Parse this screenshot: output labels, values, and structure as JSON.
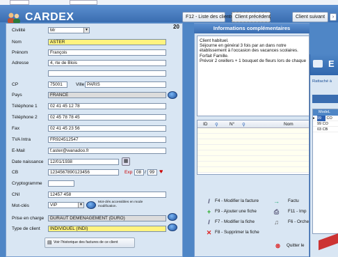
{
  "window": {
    "title": "CARDEX",
    "record_number": "20"
  },
  "toolbar": {
    "list_clients": "F12 - Liste des clients",
    "prev_client": "Client précédent",
    "next_client": "Client suivant"
  },
  "form": {
    "civilite": {
      "label": "Civilité",
      "value": "Mr"
    },
    "nom": {
      "label": "Nom",
      "value": "ASTER"
    },
    "prenom": {
      "label": "Prénom",
      "value": "François"
    },
    "adresse": {
      "label": "Adresse",
      "value": "4, rte de Blois",
      "value2": ""
    },
    "cp": {
      "label": "CP",
      "value": "75001"
    },
    "ville": {
      "label": "Ville",
      "value": "PARIS"
    },
    "pays": {
      "label": "Pays",
      "value": "FRANCE"
    },
    "tel1": {
      "label": "Téléphone 1",
      "value": "02 41 45 12 78"
    },
    "tel2": {
      "label": "Téléphone 2",
      "value": "02 45 78 78 45"
    },
    "fax": {
      "label": "Fax",
      "value": "02 41 45 23 56"
    },
    "tva": {
      "label": "TVA Intra",
      "value": "FR924512547"
    },
    "email": {
      "label": "E-Mail",
      "value": "f.aster@wanadoo.fr"
    },
    "date_naissance": {
      "label": "Date naissance",
      "value": "12/01/1938"
    },
    "cb": {
      "label": "CB",
      "value": "1234567890123456",
      "exp_label": "Exp",
      "exp_month": "08",
      "exp_year": "99"
    },
    "cryptogramme": {
      "label": "Cryptogramme",
      "value": ""
    },
    "cni": {
      "label": "CNI",
      "value": "12457 458"
    },
    "motcles": {
      "label": "Mot-clés",
      "value": "VIP",
      "hint": "Mot-clés accessibles en mode modification."
    },
    "prise_en_charge": {
      "label": "Prise en charge",
      "value": "DURAUT DEMENAGEMENT (DURO)"
    },
    "type_client": {
      "label": "Type de client",
      "value": "INDIVIDUEL (INDI)"
    },
    "historique_button": "Voir l'historique des factures de ce client"
  },
  "info": {
    "title": "Informations complémentaires",
    "notes": "Client habituel.\nSéjourne en général 3 fois par an dans notre établissement à l'occasion des vacances scolaires.\nForfait Famille.\nPrévoir 2 oreillers + 1 bouquet de fleurs lors de chaque",
    "grid_headers": [
      "ID",
      "N°",
      "Nom"
    ]
  },
  "actions": {
    "modify_invoice": "F4 - Modifier la facture",
    "invoice": "Factu",
    "add_sheet": "F9 - Ajouter une fiche",
    "f11": "F11 - Imp",
    "modify_sheet": "F7 - Modifier la fiche",
    "f6": "F6 - Orche",
    "delete_sheet": "F8 - Supprimer la fiche",
    "quit": "Quitter le"
  },
  "second_window": {
    "title_fragment": "E",
    "subtitle": "Rattaché à",
    "col_header": "ModeL",
    "rows": [
      {
        "id": "99",
        "code": "CO"
      },
      {
        "id": "99",
        "code": "CO"
      },
      {
        "id": "03",
        "code": "CB"
      }
    ]
  }
}
